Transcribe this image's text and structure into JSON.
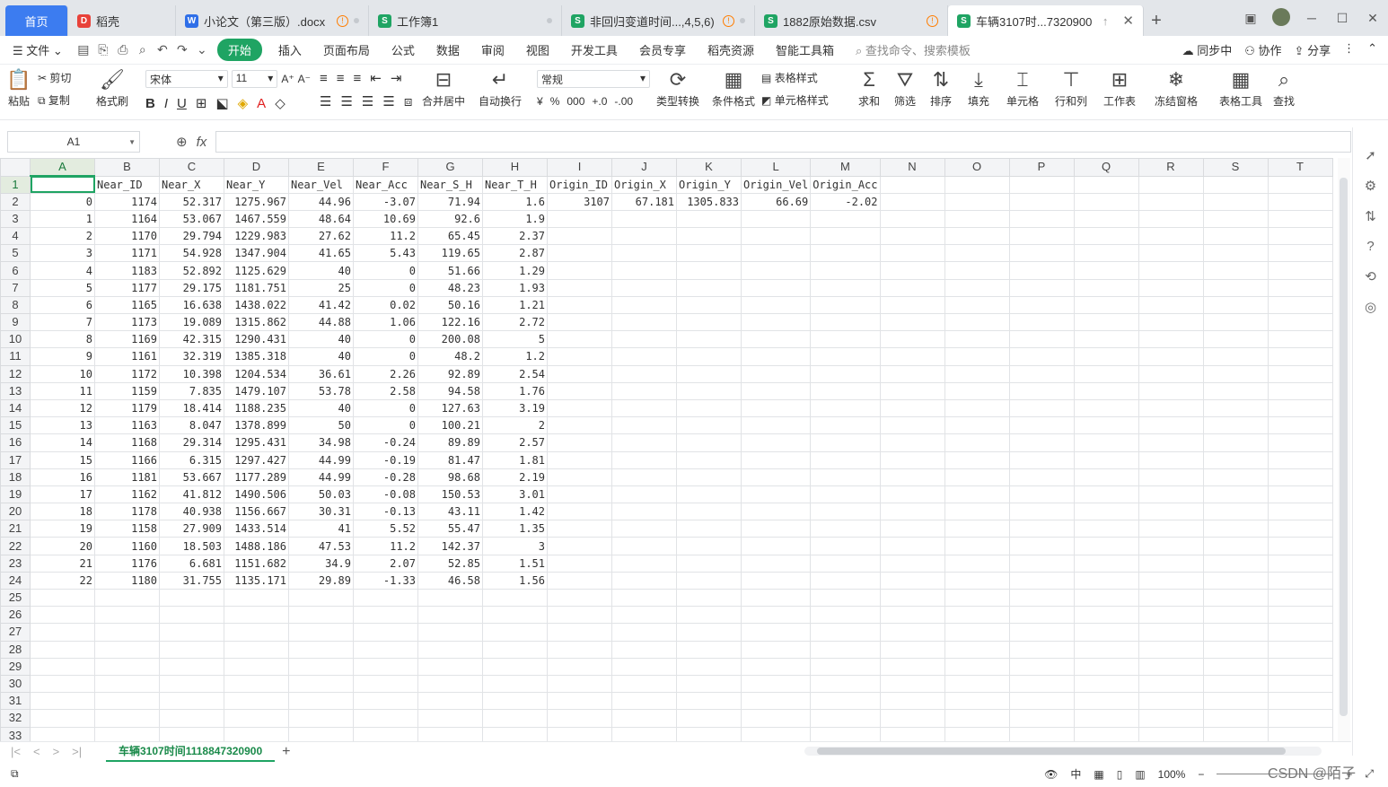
{
  "tabs": [
    {
      "label": "首页",
      "type": "home"
    },
    {
      "label": "稻壳",
      "badge": "D",
      "badge_color": "red"
    },
    {
      "label": "小论文（第三版）.docx",
      "badge": "W",
      "badge_color": "blue",
      "warn": true,
      "dot": true
    },
    {
      "label": "工作簿1",
      "badge": "S",
      "badge_color": "green",
      "dot": true
    },
    {
      "label": "非回归变道时间...,4,5,6)",
      "badge": "S",
      "badge_color": "green",
      "warn": true,
      "dot": true
    },
    {
      "label": "1882原始数据.csv",
      "badge": "S",
      "badge_color": "green",
      "warn": true
    },
    {
      "label": "车辆3107时...7320900",
      "badge": "S",
      "badge_color": "green",
      "active": true
    }
  ],
  "menu": {
    "file": "文件",
    "items": [
      "开始",
      "插入",
      "页面布局",
      "公式",
      "数据",
      "审阅",
      "视图",
      "开发工具",
      "会员专享",
      "稻壳资源",
      "智能工具箱"
    ],
    "search": "查找命令、搜索模板",
    "sync": "同步中",
    "collab": "协作",
    "share": "分享"
  },
  "ribbon": {
    "paste": "粘贴",
    "cut": "剪切",
    "copy": "复制",
    "format_painter": "格式刷",
    "font_name": "宋体",
    "font_size": "11",
    "merge": "合并居中",
    "wrap": "自动换行",
    "number_format": "常规",
    "convert": "类型转换",
    "cond_format": "条件格式",
    "table_style": "表格样式",
    "cell_style": "单元格样式",
    "sum": "求和",
    "filter": "筛选",
    "sort": "排序",
    "fill": "填充",
    "cell": "单元格",
    "rowcol": "行和列",
    "sheet": "工作表",
    "freeze": "冻结窗格",
    "table_tools": "表格工具",
    "find": "查找"
  },
  "formula_bar": {
    "cell_ref": "A1",
    "fx": "fx",
    "value": ""
  },
  "columns": [
    "A",
    "B",
    "C",
    "D",
    "E",
    "F",
    "G",
    "H",
    "I",
    "J",
    "K",
    "L",
    "M",
    "N",
    "O",
    "P",
    "Q",
    "R",
    "S",
    "T"
  ],
  "header_row": [
    "",
    "Near_ID",
    "Near_X",
    "Near_Y",
    "Near_Vel",
    "Near_Acc",
    "Near_S_H",
    "Near_T_H",
    "Origin_ID",
    "Origin_X",
    "Origin_Y",
    "Origin_Vel",
    "Origin_Acc"
  ],
  "rows": [
    [
      "0",
      "1174",
      "52.317",
      "1275.967",
      "44.96",
      "-3.07",
      "71.94",
      "1.6",
      "3107",
      "67.181",
      "1305.833",
      "66.69",
      "-2.02"
    ],
    [
      "1",
      "1164",
      "53.067",
      "1467.559",
      "48.64",
      "10.69",
      "92.6",
      "1.9"
    ],
    [
      "2",
      "1170",
      "29.794",
      "1229.983",
      "27.62",
      "11.2",
      "65.45",
      "2.37"
    ],
    [
      "3",
      "1171",
      "54.928",
      "1347.904",
      "41.65",
      "5.43",
      "119.65",
      "2.87"
    ],
    [
      "4",
      "1183",
      "52.892",
      "1125.629",
      "40",
      "0",
      "51.66",
      "1.29"
    ],
    [
      "5",
      "1177",
      "29.175",
      "1181.751",
      "25",
      "0",
      "48.23",
      "1.93"
    ],
    [
      "6",
      "1165",
      "16.638",
      "1438.022",
      "41.42",
      "0.02",
      "50.16",
      "1.21"
    ],
    [
      "7",
      "1173",
      "19.089",
      "1315.862",
      "44.88",
      "1.06",
      "122.16",
      "2.72"
    ],
    [
      "8",
      "1169",
      "42.315",
      "1290.431",
      "40",
      "0",
      "200.08",
      "5"
    ],
    [
      "9",
      "1161",
      "32.319",
      "1385.318",
      "40",
      "0",
      "48.2",
      "1.2"
    ],
    [
      "10",
      "1172",
      "10.398",
      "1204.534",
      "36.61",
      "2.26",
      "92.89",
      "2.54"
    ],
    [
      "11",
      "1159",
      "7.835",
      "1479.107",
      "53.78",
      "2.58",
      "94.58",
      "1.76"
    ],
    [
      "12",
      "1179",
      "18.414",
      "1188.235",
      "40",
      "0",
      "127.63",
      "3.19"
    ],
    [
      "13",
      "1163",
      "8.047",
      "1378.899",
      "50",
      "0",
      "100.21",
      "2"
    ],
    [
      "14",
      "1168",
      "29.314",
      "1295.431",
      "34.98",
      "-0.24",
      "89.89",
      "2.57"
    ],
    [
      "15",
      "1166",
      "6.315",
      "1297.427",
      "44.99",
      "-0.19",
      "81.47",
      "1.81"
    ],
    [
      "16",
      "1181",
      "53.667",
      "1177.289",
      "44.99",
      "-0.28",
      "98.68",
      "2.19"
    ],
    [
      "17",
      "1162",
      "41.812",
      "1490.506",
      "50.03",
      "-0.08",
      "150.53",
      "3.01"
    ],
    [
      "18",
      "1178",
      "40.938",
      "1156.667",
      "30.31",
      "-0.13",
      "43.11",
      "1.42"
    ],
    [
      "19",
      "1158",
      "27.909",
      "1433.514",
      "41",
      "5.52",
      "55.47",
      "1.35"
    ],
    [
      "20",
      "1160",
      "18.503",
      "1488.186",
      "47.53",
      "11.2",
      "142.37",
      "3"
    ],
    [
      "21",
      "1176",
      "6.681",
      "1151.682",
      "34.9",
      "2.07",
      "52.85",
      "1.51"
    ],
    [
      "22",
      "1180",
      "31.755",
      "1135.171",
      "29.89",
      "-1.33",
      "46.58",
      "1.56"
    ]
  ],
  "total_visible_rows": 33,
  "sheet_tab": "车辆3107时间1118847320900",
  "status": {
    "zoom": "100%",
    "watermark": "CSDN @陌子"
  },
  "colors": {
    "accent": "#1fa463",
    "home_tab": "#3c7cf0",
    "warn": "#ff7d00"
  }
}
